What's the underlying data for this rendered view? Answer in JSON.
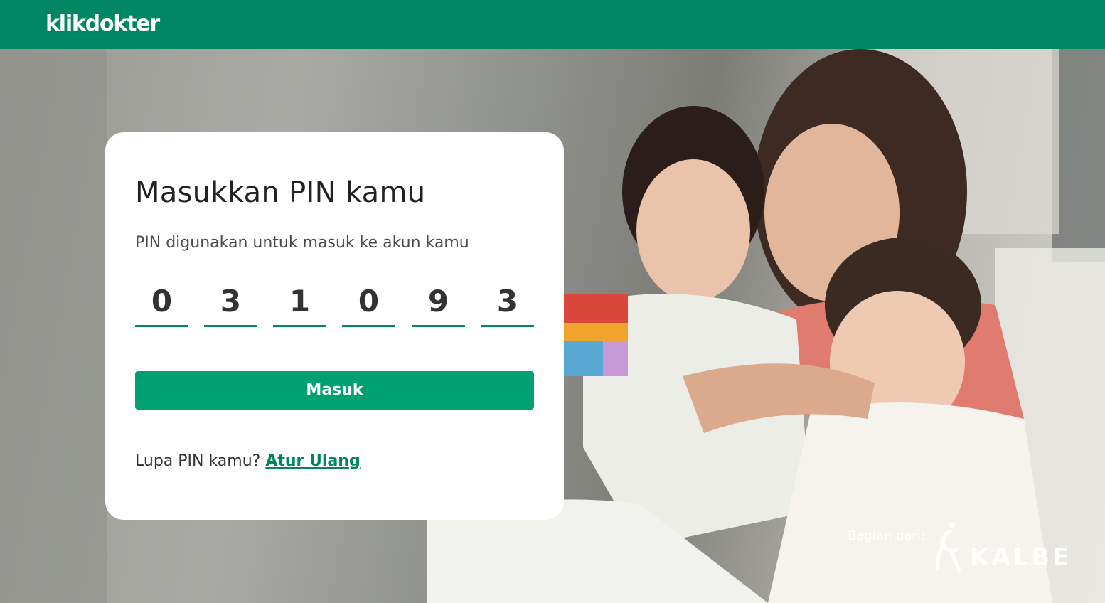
{
  "header": {
    "logo_text": "klikdokter",
    "bg_color": "#008660"
  },
  "card": {
    "title": "Masukkan PIN kamu",
    "subtitle": "PIN digunakan untuk masuk ke akun kamu",
    "pin_digits": [
      "0",
      "3",
      "1",
      "0",
      "9",
      "3"
    ],
    "submit_label": "Masuk",
    "forgot_text": "Lupa PIN kamu?",
    "reset_link": "Atur Ulang"
  },
  "footer": {
    "partner_label": "Bagian dari:",
    "partner_name": "KALBE"
  },
  "colors": {
    "brand_green": "#008660",
    "button_green": "#00a070"
  }
}
